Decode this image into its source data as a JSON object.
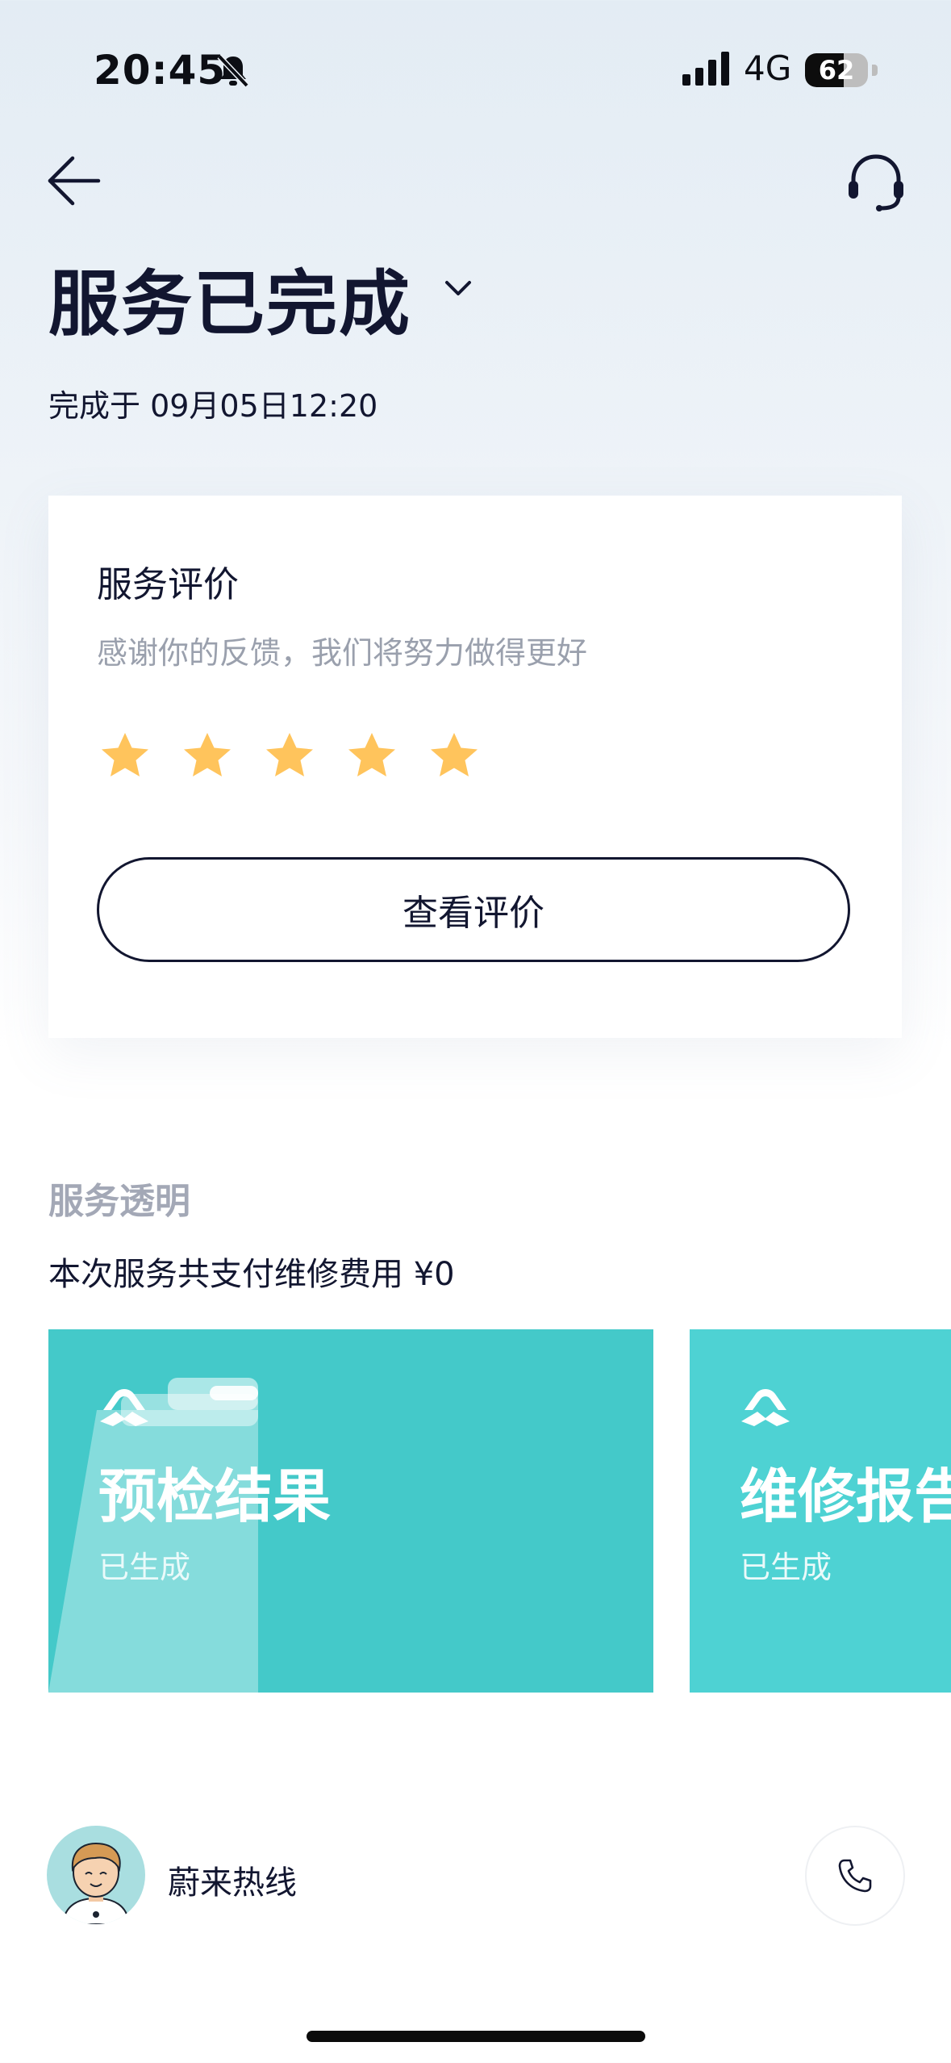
{
  "status_bar": {
    "time": "20:45",
    "network": "4G",
    "battery_level": "62",
    "battery_fraction": 0.62,
    "icons": [
      "bell-muted-icon",
      "signal-icon",
      "battery-icon"
    ]
  },
  "header": {
    "back_icon": "arrow-left-icon",
    "support_icon": "headset-icon",
    "title": "服务已完成",
    "title_toggle_icon": "chevron-down-icon",
    "completed_at": "完成于 09月05日12:20"
  },
  "rating_card": {
    "title": "服务评价",
    "description": "感谢你的反馈，我们将努力做得更好",
    "rating": 5,
    "rating_max": 5,
    "star_color": "#ffc45c",
    "button_label": "查看评价"
  },
  "transparency": {
    "title": "服务透明",
    "summary": "本次服务共支付维修费用 ¥0",
    "tiles": [
      {
        "title": "预检结果",
        "status": "已生成",
        "color": "#44c9c9"
      },
      {
        "title": "维修报告",
        "status": "已生成",
        "color": "#4ed2d3"
      }
    ]
  },
  "hotline": {
    "label": "蔚来热线",
    "icon": "phone-icon"
  }
}
